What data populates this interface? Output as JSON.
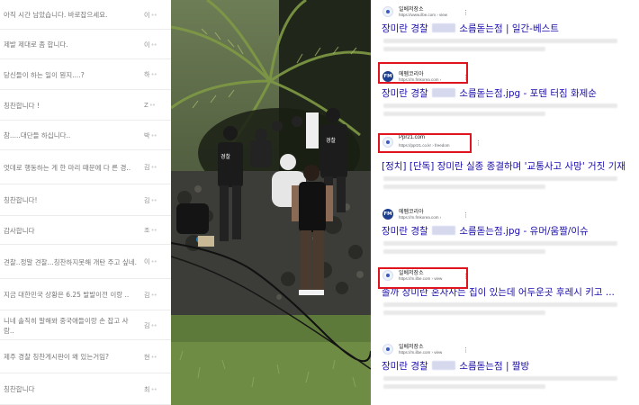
{
  "comments": [
    {
      "text": "아직 시간 남았습니다. 바로잡으세요.",
      "author": "이"
    },
    {
      "text": "제발 제대로 좀 합니다.",
      "author": "이"
    },
    {
      "text": "당신들이 하는 일이 뭔지....?",
      "author": "하"
    },
    {
      "text": "칭찬합니다 !",
      "author": "Z"
    },
    {
      "text": "참.....대단들 하십니다..",
      "author": "박"
    },
    {
      "text": "엇데로 행동하는 게 한 마리 때문에 다 른 경..",
      "author": "김"
    },
    {
      "text": "칭찬합니다!",
      "author": "김"
    },
    {
      "text": "감사합니다",
      "author": "조"
    },
    {
      "text": "견찰..정말 견찰...칭찬하지못해 개탄 주고 싶네.",
      "author": "이"
    },
    {
      "text": "지금 대한민국 상황은 6.25 발발이전 이랑 ..",
      "author": "김"
    },
    {
      "text": "니네 솔직히 말해봐 중국애들이랑 손 잡고 사람..",
      "author": "김"
    },
    {
      "text": "제주 경찰 칭찬게시판이 왜 있는거임?",
      "author": "현"
    },
    {
      "text": "칭찬합니다",
      "author": "최"
    }
  ],
  "author_mask": "••",
  "results": [
    {
      "favicon": "globe-icon",
      "site_name": "일베저장소",
      "url": "https://www.ilbe.com › view",
      "title_before": "장미란 경찰",
      "title_after": "소름돋는점 | 일간-베스트",
      "masked": true,
      "highlighted": false
    },
    {
      "favicon": "fm-icon",
      "favicon_text": "FM",
      "site_name": "에펨코리아",
      "url": "https://m.fmkorea.com ›",
      "title_before": "장미란 경찰",
      "title_after": "소름돋는점.jpg - 포텐 터짐 화제순",
      "masked": true,
      "highlighted": true
    },
    {
      "favicon": "globe-icon",
      "site_name": "Ppr21.com",
      "url": "https://ppr21.co.kr › freedom",
      "title_before": "[정치] [단독] 장미란 실종 종결하며 '교통사고 사망' 거짓 기재",
      "title_after": "",
      "masked": false,
      "highlighted": true
    },
    {
      "favicon": "fm-icon",
      "favicon_text": "FM",
      "site_name": "에펨코리아",
      "url": "https://m.fmkorea.com ›",
      "title_before": "장미란 경찰",
      "title_after": "소름돋는점.jpg - 유머/움짤/이슈",
      "masked": true,
      "highlighted": false
    },
    {
      "favicon": "globe-icon",
      "site_name": "일베저장소",
      "url": "https://m.ilbe.com › view",
      "title_before": "솔까 장미란 혼자사는 집이 있는데 어두운곳 후레시 키고 ...",
      "title_after": "",
      "masked": false,
      "highlighted": true
    },
    {
      "favicon": "globe-icon",
      "site_name": "일베저장소",
      "url": "https://m.ilbe.com › view",
      "title_before": "장미란 경찰",
      "title_after": "소름돋는점 | 짤방",
      "masked": true,
      "highlighted": false
    }
  ],
  "more_icon": "⋮",
  "colors": {
    "result_title": "#1a0dab",
    "highlight_box": "#e0141e",
    "comment_text": "#777777"
  }
}
